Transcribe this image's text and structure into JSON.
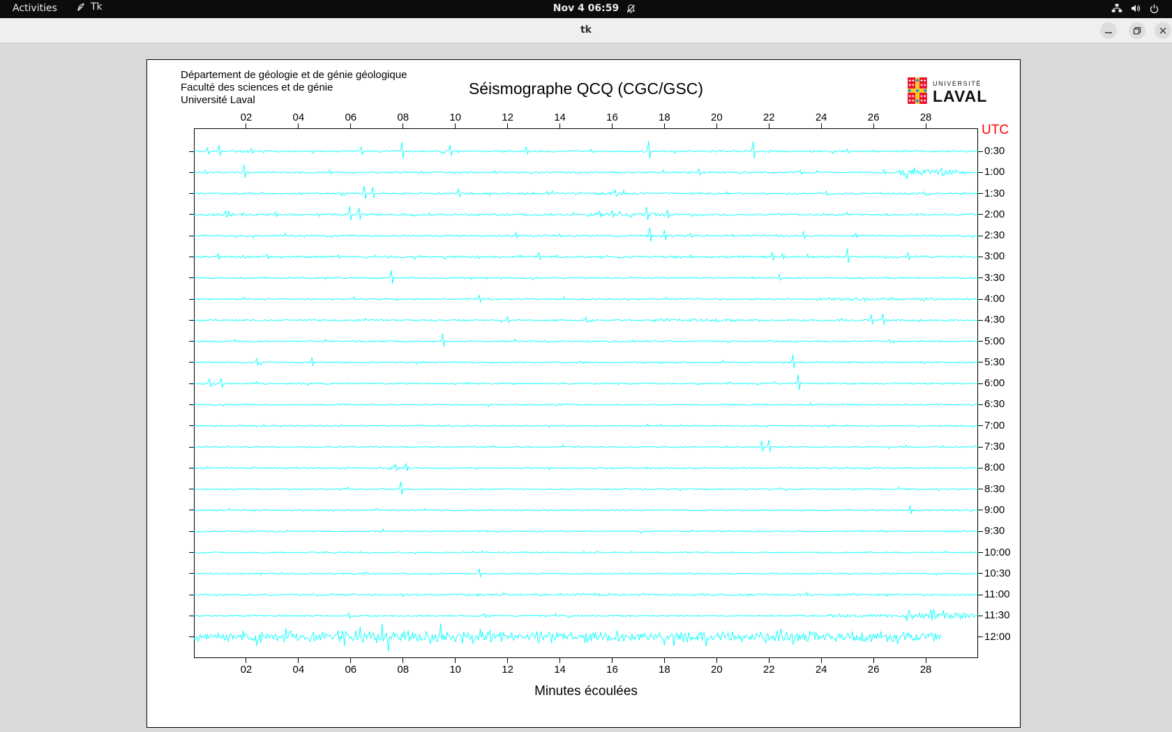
{
  "topbar": {
    "activities": "Activities",
    "app_label": "Tk",
    "clock": "Nov 4  06:59"
  },
  "titlebar": {
    "title": "tk"
  },
  "header": {
    "dept_lines": [
      "Département de géologie et de génie géologique",
      "Faculté des sciences et de génie",
      "Université Laval"
    ],
    "logo": {
      "line1": "UNIVERSITÉ",
      "line2": "LAVAL"
    }
  },
  "chart_data": {
    "type": "line",
    "subtype": "seismogram-helicorder",
    "title": "Séismographe QCQ (CGC/GSC)",
    "xlabel": "Minutes écoulées",
    "right_axis_label": "UTC",
    "x_range": [
      0,
      30
    ],
    "x_ticks": [
      "02",
      "04",
      "06",
      "08",
      "10",
      "12",
      "14",
      "16",
      "18",
      "20",
      "22",
      "24",
      "26",
      "28"
    ],
    "grid": false,
    "trace_color": "#00ffff",
    "background": "#ffffff",
    "rows": [
      {
        "label": "0:30",
        "base": 1.1,
        "spikes": [
          [
            0.5,
            5
          ],
          [
            0.95,
            9
          ],
          [
            2.2,
            4
          ],
          [
            6.4,
            6
          ],
          [
            7.95,
            13
          ],
          [
            9.8,
            9
          ],
          [
            12.7,
            6
          ],
          [
            15.2,
            3
          ],
          [
            17.4,
            15
          ],
          [
            21.4,
            14
          ],
          [
            25.0,
            3
          ]
        ],
        "bursts": [
          [
            1.5,
            3.0,
            1.8
          ]
        ]
      },
      {
        "label": "1:00",
        "base": 1.1,
        "spikes": [
          [
            0.45,
            3
          ],
          [
            1.9,
            11
          ],
          [
            5.2,
            3.5
          ],
          [
            11.5,
            2.5
          ],
          [
            19.3,
            5
          ],
          [
            23.2,
            3.5
          ],
          [
            26.4,
            4
          ],
          [
            28.6,
            7
          ]
        ],
        "bursts": [
          [
            26.8,
            29.6,
            4
          ]
        ]
      },
      {
        "label": "1:30",
        "base": 1.1,
        "spikes": [
          [
            6.5,
            11
          ],
          [
            6.85,
            9
          ],
          [
            10.1,
            6
          ],
          [
            13.5,
            3
          ],
          [
            16.1,
            5
          ],
          [
            20.4,
            2.5
          ],
          [
            24.2,
            3.5
          ],
          [
            27.9,
            2.5
          ]
        ],
        "bursts": [
          [
            15.4,
            16.6,
            2.6
          ]
        ]
      },
      {
        "label": "2:00",
        "base": 1.2,
        "spikes": [
          [
            1.2,
            5
          ],
          [
            3.1,
            4
          ],
          [
            5.95,
            12
          ],
          [
            6.3,
            10
          ],
          [
            9.0,
            2.5
          ],
          [
            15.5,
            5
          ],
          [
            16.0,
            6
          ],
          [
            17.3,
            11
          ],
          [
            18.1,
            7
          ]
        ],
        "bursts": [
          [
            0.5,
            2.2,
            2.6
          ],
          [
            14.8,
            18.3,
            2.2
          ]
        ]
      },
      {
        "label": "2:30",
        "base": 1.1,
        "spikes": [
          [
            12.3,
            4.5
          ],
          [
            14.0,
            2.5
          ],
          [
            17.45,
            12
          ],
          [
            18.0,
            8
          ],
          [
            19.0,
            3.5
          ],
          [
            20.6,
            2.5
          ],
          [
            23.3,
            6
          ],
          [
            25.3,
            3.5
          ]
        ],
        "bursts": [
          [
            17.0,
            19.2,
            2.0
          ]
        ]
      },
      {
        "label": "3:00",
        "base": 1.4,
        "spikes": [
          [
            0.9,
            4.5
          ],
          [
            2.8,
            3.5
          ],
          [
            5.5,
            2.5
          ],
          [
            13.2,
            6
          ],
          [
            19.0,
            2.5
          ],
          [
            22.1,
            7
          ],
          [
            22.5,
            4.5
          ],
          [
            25.0,
            12
          ],
          [
            27.3,
            6
          ]
        ],
        "bursts": []
      },
      {
        "label": "3:30",
        "base": 1.0,
        "spikes": [
          [
            7.55,
            11
          ],
          [
            22.4,
            4.5
          ]
        ],
        "bursts": []
      },
      {
        "label": "4:00",
        "base": 1.0,
        "spikes": [
          [
            10.9,
            5.5
          ]
        ],
        "bursts": [
          [
            23.5,
            30,
            1.8
          ]
        ]
      },
      {
        "label": "4:30",
        "base": 1.1,
        "spikes": [
          [
            12.0,
            5
          ],
          [
            15.0,
            4.5
          ],
          [
            25.9,
            8
          ],
          [
            26.35,
            9
          ]
        ],
        "bursts": [
          [
            17.3,
            21.0,
            1.9
          ]
        ]
      },
      {
        "label": "5:00",
        "base": 1.0,
        "spikes": [
          [
            9.5,
            11
          ],
          [
            16.8,
            2
          ],
          [
            26.6,
            2.5
          ]
        ],
        "bursts": []
      },
      {
        "label": "5:30",
        "base": 1.0,
        "spikes": [
          [
            2.4,
            5.5
          ],
          [
            4.5,
            7
          ],
          [
            14.8,
            2
          ],
          [
            22.9,
            11
          ]
        ],
        "bursts": []
      },
      {
        "label": "6:00",
        "base": 1.0,
        "spikes": [
          [
            0.6,
            7
          ],
          [
            1.05,
            8
          ],
          [
            23.1,
            13
          ]
        ],
        "bursts": []
      },
      {
        "label": "6:30",
        "base": 0.9,
        "spikes": [
          [
            14.0,
            1.8
          ],
          [
            23.6,
            2.5
          ]
        ],
        "bursts": []
      },
      {
        "label": "7:00",
        "base": 0.9,
        "spikes": [
          [
            10.5,
            1.5
          ]
        ],
        "bursts": []
      },
      {
        "label": "7:30",
        "base": 0.9,
        "spikes": [
          [
            21.7,
            9
          ],
          [
            22.0,
            10
          ]
        ],
        "bursts": []
      },
      {
        "label": "8:00",
        "base": 1.0,
        "spikes": [
          [
            7.7,
            5
          ],
          [
            8.1,
            6
          ]
        ],
        "bursts": [
          [
            7.2,
            8.4,
            3.2
          ]
        ]
      },
      {
        "label": "8:30",
        "base": 0.9,
        "spikes": [
          [
            7.9,
            11
          ]
        ],
        "bursts": []
      },
      {
        "label": "9:00",
        "base": 0.9,
        "spikes": [
          [
            27.4,
            7
          ]
        ],
        "bursts": []
      },
      {
        "label": "9:30",
        "base": 0.9,
        "spikes": [
          [
            11.2,
            1.5
          ]
        ],
        "bursts": []
      },
      {
        "label": "10:00",
        "base": 0.9,
        "spikes": [],
        "bursts": []
      },
      {
        "label": "10:30",
        "base": 0.9,
        "spikes": [
          [
            10.9,
            7
          ]
        ],
        "bursts": []
      },
      {
        "label": "11:00",
        "base": 1.3,
        "spikes": [],
        "bursts": []
      },
      {
        "label": "11:30",
        "base": 1.0,
        "spikes": [
          [
            5.9,
            4.5
          ],
          [
            11.1,
            3.5
          ],
          [
            28.2,
            9
          ]
        ],
        "bursts": [
          [
            24.0,
            27.0,
            2.2
          ],
          [
            27.0,
            30.0,
            4.5
          ]
        ]
      },
      {
        "label": "12:00",
        "base": 5.5,
        "end": 28.6,
        "spikes": [
          [
            5.5,
            9
          ],
          [
            8.2,
            9
          ],
          [
            11.3,
            10
          ],
          [
            13.1,
            8
          ],
          [
            16.2,
            9
          ],
          [
            19.4,
            8
          ],
          [
            22.3,
            9
          ],
          [
            25.2,
            8
          ]
        ],
        "bursts": [
          [
            4.5,
            12,
            6.5
          ],
          [
            20,
            26,
            6.2
          ]
        ]
      }
    ]
  }
}
